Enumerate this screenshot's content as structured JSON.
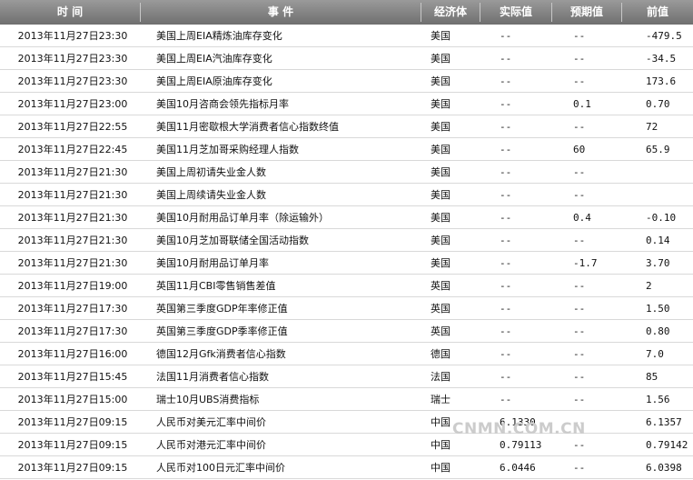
{
  "headers": {
    "time": "时 间",
    "event": "事 件",
    "economy": "经济体",
    "actual": "实际值",
    "forecast": "预期值",
    "previous": "前值"
  },
  "rows": [
    {
      "time": "2013年11月27日23:30",
      "event": "美国上周EIA精炼油库存变化",
      "economy": "美国",
      "actual": "--",
      "forecast": "--",
      "previous": "-479.5"
    },
    {
      "time": "2013年11月27日23:30",
      "event": "美国上周EIA汽油库存变化",
      "economy": "美国",
      "actual": "--",
      "forecast": "--",
      "previous": "-34.5"
    },
    {
      "time": "2013年11月27日23:30",
      "event": "美国上周EIA原油库存变化",
      "economy": "美国",
      "actual": "--",
      "forecast": "--",
      "previous": "173.6"
    },
    {
      "time": "2013年11月27日23:00",
      "event": "美国10月咨商会领先指标月率",
      "economy": "美国",
      "actual": "--",
      "forecast": "0.1",
      "previous": "0.70"
    },
    {
      "time": "2013年11月27日22:55",
      "event": "美国11月密歇根大学消费者信心指数终值",
      "economy": "美国",
      "actual": "--",
      "forecast": "--",
      "previous": "72"
    },
    {
      "time": "2013年11月27日22:45",
      "event": "美国11月芝加哥采购经理人指数",
      "economy": "美国",
      "actual": "--",
      "forecast": "60",
      "previous": "65.9"
    },
    {
      "time": "2013年11月27日21:30",
      "event": "美国上周初请失业金人数",
      "economy": "美国",
      "actual": "--",
      "forecast": "--",
      "previous": ""
    },
    {
      "time": "2013年11月27日21:30",
      "event": "美国上周续请失业金人数",
      "economy": "美国",
      "actual": "--",
      "forecast": "--",
      "previous": ""
    },
    {
      "time": "2013年11月27日21:30",
      "event": "美国10月耐用品订单月率（除运输外）",
      "economy": "美国",
      "actual": "--",
      "forecast": "0.4",
      "previous": "-0.10"
    },
    {
      "time": "2013年11月27日21:30",
      "event": "美国10月芝加哥联储全国活动指数",
      "economy": "美国",
      "actual": "--",
      "forecast": "--",
      "previous": "0.14"
    },
    {
      "time": "2013年11月27日21:30",
      "event": "美国10月耐用品订单月率",
      "economy": "美国",
      "actual": "--",
      "forecast": "-1.7",
      "previous": "3.70"
    },
    {
      "time": "2013年11月27日19:00",
      "event": "英国11月CBI零售销售差值",
      "economy": "英国",
      "actual": "--",
      "forecast": "--",
      "previous": "2"
    },
    {
      "time": "2013年11月27日17:30",
      "event": "英国第三季度GDP年率修正值",
      "economy": "英国",
      "actual": "--",
      "forecast": "--",
      "previous": "1.50"
    },
    {
      "time": "2013年11月27日17:30",
      "event": "英国第三季度GDP季率修正值",
      "economy": "英国",
      "actual": "--",
      "forecast": "--",
      "previous": "0.80"
    },
    {
      "time": "2013年11月27日16:00",
      "event": "德国12月Gfk消费者信心指数",
      "economy": "德国",
      "actual": "--",
      "forecast": "--",
      "previous": "7.0"
    },
    {
      "time": "2013年11月27日15:45",
      "event": "法国11月消费者信心指数",
      "economy": "法国",
      "actual": "--",
      "forecast": "--",
      "previous": "85"
    },
    {
      "time": "2013年11月27日15:00",
      "event": "瑞士10月UBS消费指标",
      "economy": "瑞士",
      "actual": "--",
      "forecast": "--",
      "previous": "1.56"
    },
    {
      "time": "2013年11月27日09:15",
      "event": "人民币对美元汇率中间价",
      "economy": "中国",
      "actual": "6.1330",
      "forecast": "--",
      "previous": "6.1357"
    },
    {
      "time": "2013年11月27日09:15",
      "event": "人民币对港元汇率中间价",
      "economy": "中国",
      "actual": "0.79113",
      "forecast": "--",
      "previous": "0.79142"
    },
    {
      "time": "2013年11月27日09:15",
      "event": "人民币对100日元汇率中间价",
      "economy": "中国",
      "actual": "6.0446",
      "forecast": "--",
      "previous": "6.0398"
    }
  ],
  "watermark": "CNMN.COM.CN"
}
